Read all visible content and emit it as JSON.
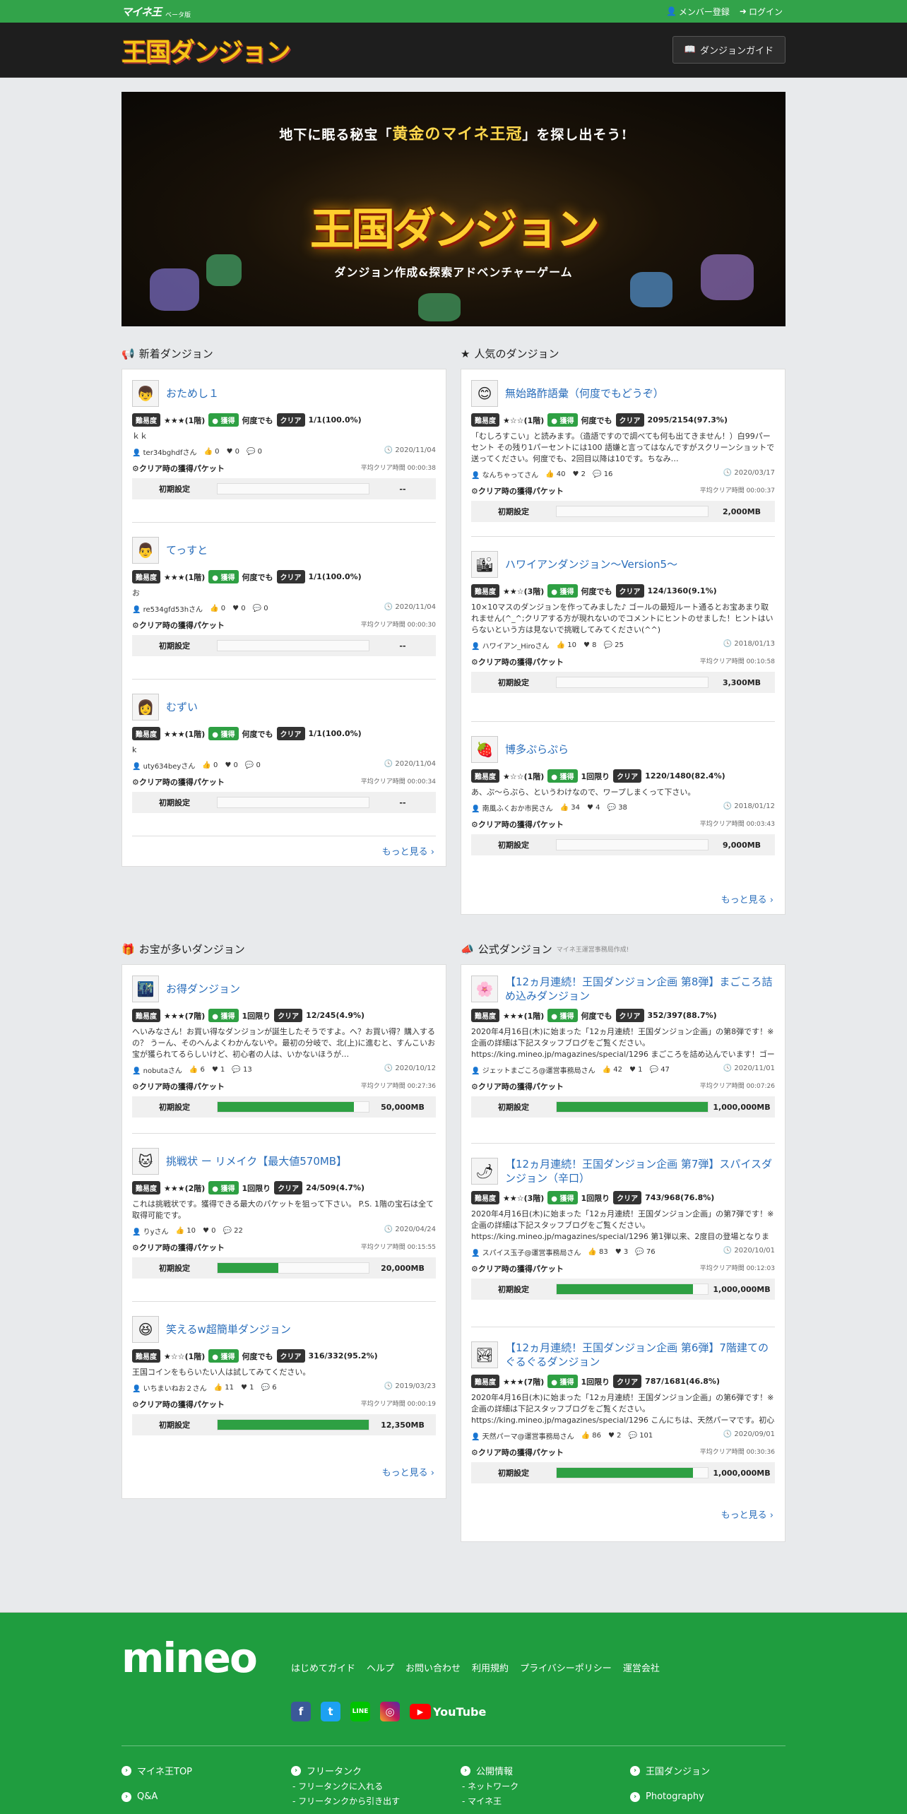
{
  "topbar": {
    "logo": "マイネ王",
    "sub": "ベータ版",
    "register": "メンバー登録",
    "login": "ログイン"
  },
  "header": {
    "logo": "王国ダンジョン",
    "guide": "ダンジョンガイド"
  },
  "banner": {
    "tag_pre": "地下に眠る秘宝「",
    "tag_mid": "黄金のマイネ王冠",
    "tag_post": "」を探し出そう!",
    "title": "王国ダンジョン",
    "subtitle": "ダンジョン作成&探索アドベンチャーゲーム"
  },
  "common": {
    "difficulty": "難易度",
    "get": "獲得",
    "clear": "クリア",
    "packet": "クリア時の獲得パケット",
    "initial": "初期設定",
    "more": "もっと見る"
  },
  "sections": {
    "new": "新着ダンジョン",
    "popular": "人気のダンジョン",
    "treasure": "お宝が多いダンジョン",
    "official": "公式ダンジョン",
    "official_note": "マイネ王運営事務局作成!"
  },
  "new_items": [
    {
      "title": "おためし１",
      "stars": "★★★(1階)",
      "get": "何度でも",
      "clear": "1/1(100.0%)",
      "desc": "ｋｋ",
      "user": "ter34bghdfさん",
      "likes": "0",
      "hearts": "0",
      "comments": "0",
      "date": "2020/11/04",
      "avg": "平均クリア時間 00:00:38",
      "packet": "--",
      "fill": 0
    },
    {
      "title": "てっすと",
      "stars": "★★★(1階)",
      "get": "何度でも",
      "clear": "1/1(100.0%)",
      "desc": "お",
      "user": "re534gfd53hさん",
      "likes": "0",
      "hearts": "0",
      "comments": "0",
      "date": "2020/11/04",
      "avg": "平均クリア時間 00:00:30",
      "packet": "--",
      "fill": 0
    },
    {
      "title": "むずい",
      "stars": "★★★(1階)",
      "get": "何度でも",
      "clear": "1/1(100.0%)",
      "desc": "k",
      "user": "uty634beyさん",
      "likes": "0",
      "hearts": "0",
      "comments": "0",
      "date": "2020/11/04",
      "avg": "平均クリア時間 00:00:34",
      "packet": "--",
      "fill": 0
    }
  ],
  "popular_items": [
    {
      "title": "無始路酢語彙（何度でもどうぞ）",
      "stars": "★☆☆(1階)",
      "get": "何度でも",
      "clear": "2095/2154(97.3%)",
      "desc": "「むしろすこい」と読みます。（造語ですので調べても何も出てきません！）白99パーセント その残り1パーセントには100 語嫌と言ってはなんですがスクリーンショットで送ってください。何度でも、2回目以降は10です。ちなみ…",
      "user": "なんちゃってさん",
      "likes": "40",
      "hearts": "2",
      "comments": "16",
      "date": "2020/03/17",
      "avg": "平均クリア時間 00:00:37",
      "packet": "2,000MB",
      "fill": 0
    },
    {
      "title": "ハワイアンダンジョン～Version5～",
      "stars": "★★☆(3階)",
      "get": "何度でも",
      "clear": "124/1360(9.1%)",
      "desc": "10×10マスのダンジョンを作ってみました♪ ゴールの最短ルート通るとお宝あまり取れません(^_^;クリアする方が現れないのでコメントにヒントのせました！ヒントはいらないという方は見ないで挑戦してみてください(^^)",
      "user": "ハワイアン_Hiroさん",
      "likes": "10",
      "hearts": "8",
      "comments": "25",
      "date": "2018/01/13",
      "avg": "平均クリア時間 00:10:58",
      "packet": "3,300MB",
      "fill": 0
    },
    {
      "title": "博多ぷらぷら",
      "stars": "★☆☆(1階)",
      "get": "1回限り",
      "clear": "1220/1480(82.4%)",
      "desc": "あ、ぷ～らぷら、というわけなので、ワープしまくって下さい。",
      "user": "南風ふくおか市民さん",
      "likes": "34",
      "hearts": "4",
      "comments": "38",
      "date": "2018/01/12",
      "avg": "平均クリア時間 00:03:43",
      "packet": "9,000MB",
      "fill": 0
    }
  ],
  "treasure_items": [
    {
      "title": "お得ダンジョン",
      "stars": "★★★(7階)",
      "get": "1回限り",
      "clear": "12/245(4.9%)",
      "desc": "へいみなさん！お買い得なダンジョンが誕生したそうですよ。へ？お買い得？購入するの？ うーん、そのへんよくわかんないや。最初の分岐で、北(上)に進むと、すんこいお宝が獲られてるらしいけど、初心者の人は、いかないほうが…",
      "user": "nobutaさん",
      "likes": "6",
      "hearts": "1",
      "comments": "13",
      "date": "2020/10/12",
      "avg": "平均クリア時間 00:27:36",
      "packet": "50,000MB",
      "fill": 0.9
    },
    {
      "title": "挑戦状 ー リメイク【最大値570MB】",
      "stars": "★★★(2階)",
      "get": "1回限り",
      "clear": "24/509(4.7%)",
      "desc": "これは挑戦状です。獲得できる最大のパケットを狙って下さい。 P.S. 1階の宝石は全て取得可能です。",
      "user": "りyさん",
      "likes": "10",
      "hearts": "0",
      "comments": "22",
      "date": "2020/04/24",
      "avg": "平均クリア時間 00:15:55",
      "packet": "20,000MB",
      "fill": 0.4
    },
    {
      "title": "笑えるw超簡単ダンジョン",
      "stars": "★☆☆(1階)",
      "get": "何度でも",
      "clear": "316/332(95.2%)",
      "desc": "王国コインをもらいたい人は試してみてください。",
      "user": "いちまいねお２さん",
      "likes": "11",
      "hearts": "1",
      "comments": "6",
      "date": "2019/03/23",
      "avg": "平均クリア時間 00:00:19",
      "packet": "12,350MB",
      "fill": 1.0
    }
  ],
  "official_items": [
    {
      "title": "【12ヵ月連続！王国ダンジョン企画 第8弾】まごころ詰め込みダンジョン",
      "stars": "★★★(1階)",
      "get": "何度でも",
      "clear": "352/397(88.7%)",
      "desc": "2020年4月16日(木)に始まった「12ヵ月連続！王国ダンジョン企画」の第8弾です！※企画の詳細は下記スタッフブログをご覧ください。 https://king.mineo.jp/magazines/special/1296 まごころを詰め込んでいます！ゴールまでの道のり…",
      "user": "ジェットまごころ@運営事務局さん",
      "likes": "42",
      "hearts": "1",
      "comments": "47",
      "date": "2020/11/01",
      "avg": "平均クリア時間 00:07:26",
      "packet": "1,000,000MB",
      "fill": 1.0
    },
    {
      "title": "【12ヵ月連続！王国ダンジョン企画 第7弾】スパイスダンジョン（辛口）",
      "stars": "★★☆(3階)",
      "get": "1回限り",
      "clear": "743/968(76.8%)",
      "desc": "2020年4月16日(木)に始まった「12ヵ月連続！王国ダンジョン企画」の第7弾です！※企画の詳細は下記スタッフブログをご覧ください。 https://king.mineo.jp/magazines/special/1296 第1弾以来、2度目の登場となりました。今回のダン…",
      "user": "スパイス玉子@運営事務局さん",
      "likes": "83",
      "hearts": "3",
      "comments": "76",
      "date": "2020/10/01",
      "avg": "平均クリア時間 00:12:03",
      "packet": "1,000,000MB",
      "fill": 0.9
    },
    {
      "title": "【12ヵ月連続！王国ダンジョン企画 第6弾】7階建てのぐるぐるダンジョン",
      "stars": "★★★(7階)",
      "get": "1回限り",
      "clear": "787/1681(46.8%)",
      "desc": "2020年4月16日(木)に始まった「12ヵ月連続！王国ダンジョン企画」の第6弾です！※企画の詳細は下記スタッフブログをご覧ください。 https://king.mineo.jp/magazines/special/1296 こんにちは、天然パーマです。初心者あるあるで…",
      "user": "天然パーマ@運営事務局さん",
      "likes": "86",
      "hearts": "2",
      "comments": "101",
      "date": "2020/09/01",
      "avg": "平均クリア時間 00:30:36",
      "packet": "1,000,000MB",
      "fill": 0.9
    }
  ],
  "footer": {
    "logo": "mineo",
    "links": [
      "はじめてガイド",
      "ヘルプ",
      "お問い合わせ",
      "利用規約",
      "プライバシーポリシー",
      "運営会社"
    ],
    "col1": [
      "マイネ王TOP",
      "Q&A"
    ],
    "col2": "フリータンク",
    "col2_sub": [
      "- フリータンクに入れる",
      "- フリータンクから引き出す"
    ],
    "col3": "公開情報",
    "col3_sub": [
      "- ネットワーク",
      "- マイネ王"
    ],
    "col4": [
      "王国ダンジョン",
      "Photography"
    ],
    "youtube": "YouTube"
  },
  "colors": {
    "green": "#2ea043",
    "link": "#2a6ebb",
    "header": "#1e1e1e"
  }
}
